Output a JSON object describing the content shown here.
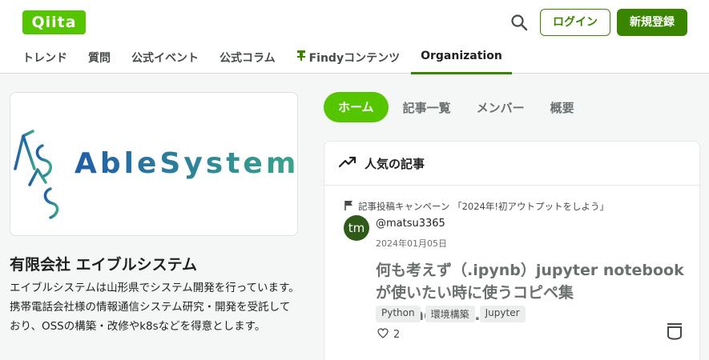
{
  "header": {
    "logo_text": "Qiita",
    "login_label": "ログイン",
    "signup_label": "新規登録",
    "brand_color": "#55c500",
    "accent_color": "#3a8500"
  },
  "nav": {
    "items": [
      {
        "label": "トレンド"
      },
      {
        "label": "質問"
      },
      {
        "label": "公式イベント"
      },
      {
        "label": "公式コラム"
      },
      {
        "label": "Findyコンテンツ"
      },
      {
        "label": "Organization"
      }
    ],
    "active": "Organization"
  },
  "org": {
    "logo_text": "AbleSystem",
    "name": "有限会社 エイブルシステム",
    "description": "エイブルシステムは山形県でシステム開発を行っています。 携帯電話会社様の情報通信システム研究・開発を受託しており、OSSの構築・改修やk8sなどを得意とします。"
  },
  "tabs": [
    {
      "label": "ホーム"
    },
    {
      "label": "記事一覧"
    },
    {
      "label": "メンバー"
    },
    {
      "label": "概要"
    }
  ],
  "popular": {
    "title": "人気の記事",
    "article": {
      "campaign": "記事投稿キャンペーン 「2024年!初アウトプットをしよう」",
      "avatar_initials": "tm",
      "author": "@matsu3365",
      "date": "2024年01月05日",
      "title": "何も考えず（.ipynb）jupyter notebookが使いたい時に使うコピペ集【Window・...",
      "tags": [
        "Python",
        "環境構築",
        "Jupyter"
      ],
      "likes": "2"
    }
  }
}
